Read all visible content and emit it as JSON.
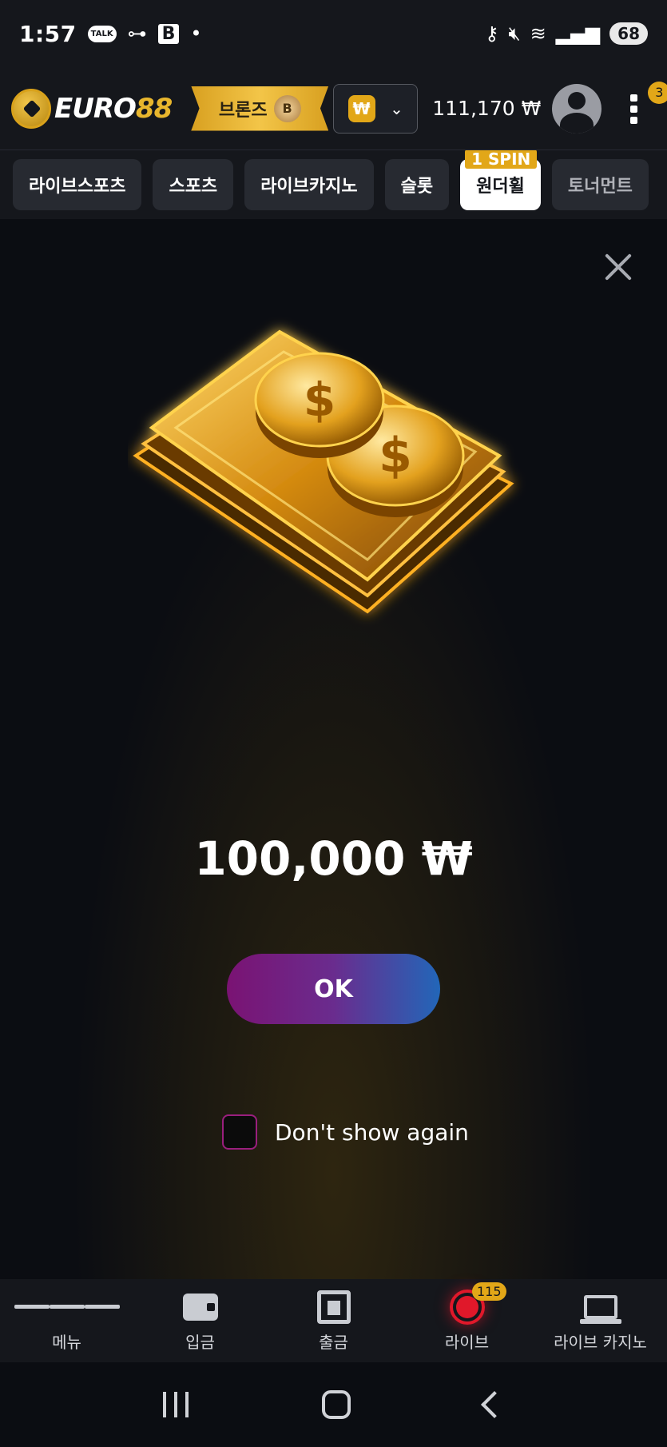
{
  "status_bar": {
    "time": "1:57",
    "battery": "68"
  },
  "header": {
    "logo_word": "EURO",
    "logo_number": "88",
    "rank_label": "브론즈",
    "rank_badge": "B",
    "currency_symbol": "₩",
    "balance": "111,170 ₩",
    "notification_count": "3"
  },
  "tabs": [
    {
      "label": "라이브스포츠"
    },
    {
      "label": "스포츠"
    },
    {
      "label": "라이브카지노"
    },
    {
      "label": "슬롯"
    },
    {
      "label": "원더휠",
      "badge": "1 SPIN"
    },
    {
      "label": "토너먼트"
    }
  ],
  "popup": {
    "amount": "100,000 ₩",
    "ok_label": "OK",
    "dont_show_label": "Don't show again",
    "dont_show_checked": false
  },
  "bottom_nav": [
    {
      "label": "메뉴"
    },
    {
      "label": "입금"
    },
    {
      "label": "출금"
    },
    {
      "label": "라이브",
      "badge": "115"
    },
    {
      "label": "라이브 카지노"
    }
  ],
  "colors": {
    "accent_gold": "#e2a718",
    "live_red": "#e0182a",
    "ok_gradient_start": "#7a1373",
    "ok_gradient_end": "#2266b8"
  }
}
